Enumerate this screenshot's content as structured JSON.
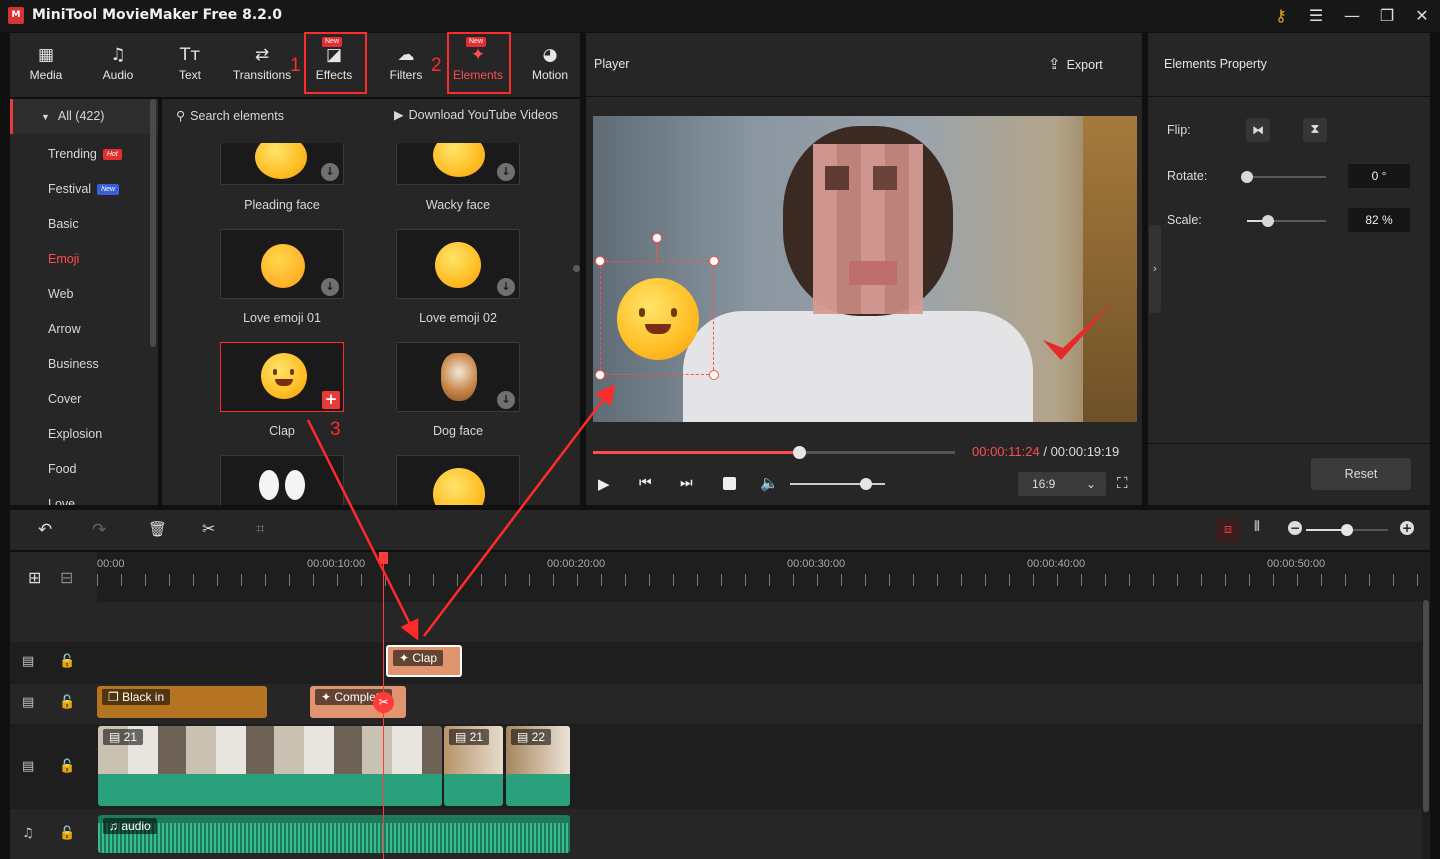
{
  "app": {
    "title": "MiniTool MovieMaker Free 8.2.0",
    "logo": "M"
  },
  "toolbar": {
    "new_badge": "New",
    "tabs": [
      {
        "label": "Media",
        "icon": "media-icon"
      },
      {
        "label": "Audio",
        "icon": "music-note-icon"
      },
      {
        "label": "Text",
        "icon": "text-icon"
      },
      {
        "label": "Transitions",
        "icon": "transitions-icon"
      },
      {
        "label": "Effects",
        "icon": "effects-icon"
      },
      {
        "label": "Filters",
        "icon": "filters-icon"
      },
      {
        "label": "Elements",
        "icon": "elements-icon"
      },
      {
        "label": "Motion",
        "icon": "motion-icon"
      }
    ],
    "active": "Elements"
  },
  "annotations": {
    "m1": "1",
    "m2": "2",
    "m3": "3",
    "color": "#ff2a2a"
  },
  "categories": {
    "all": "All (422)",
    "hot_badge": "Hot",
    "new_badge": "New",
    "items": [
      "Trending",
      "Festival",
      "Basic",
      "Emoji",
      "Web",
      "Arrow",
      "Business",
      "Cover",
      "Explosion",
      "Food",
      "Love"
    ],
    "selected": "Emoji"
  },
  "media": {
    "search_placeholder": "Search elements",
    "youtube_link": "Download YouTube Videos",
    "items": [
      "Pleading face",
      "Wacky face",
      "Love emoji 01",
      "Love emoji 02",
      "Clap",
      "Dog face"
    ],
    "download_glyph": "↓",
    "add_glyph": "+"
  },
  "player": {
    "title": "Player",
    "export_label": "Export",
    "current_time": "00:00:11:24",
    "separator": " / ",
    "total_time": "00:00:19:19",
    "progress": 0.57,
    "volume": 0.8,
    "aspect": "16:9"
  },
  "properties": {
    "title": "Elements Property",
    "flip_label": "Flip:",
    "rotate_label": "Rotate:",
    "rotate_value": "0 °",
    "rotate_level": 0.0,
    "scale_label": "Scale:",
    "scale_value": "82 %",
    "scale_level": 0.27,
    "reset_label": "Reset"
  },
  "timeline": {
    "ruler": [
      "00:00",
      "00:00:10:00",
      "00:00:20:00",
      "00:00:30:00",
      "00:00:40:00",
      "00:00:50:00"
    ],
    "clips": {
      "clap": "Clap",
      "black_in": "Black in",
      "complete": "Complete",
      "video_a": "21",
      "video_b": "21",
      "video_c": "22",
      "audio": "audio"
    },
    "zoom_level": 0.5
  },
  "colors": {
    "accent": "#ff4d4d",
    "clip_orange": "#e09570",
    "clip_brown": "#b57422",
    "clip_green": "#2ba07d",
    "panel": "#262626"
  }
}
